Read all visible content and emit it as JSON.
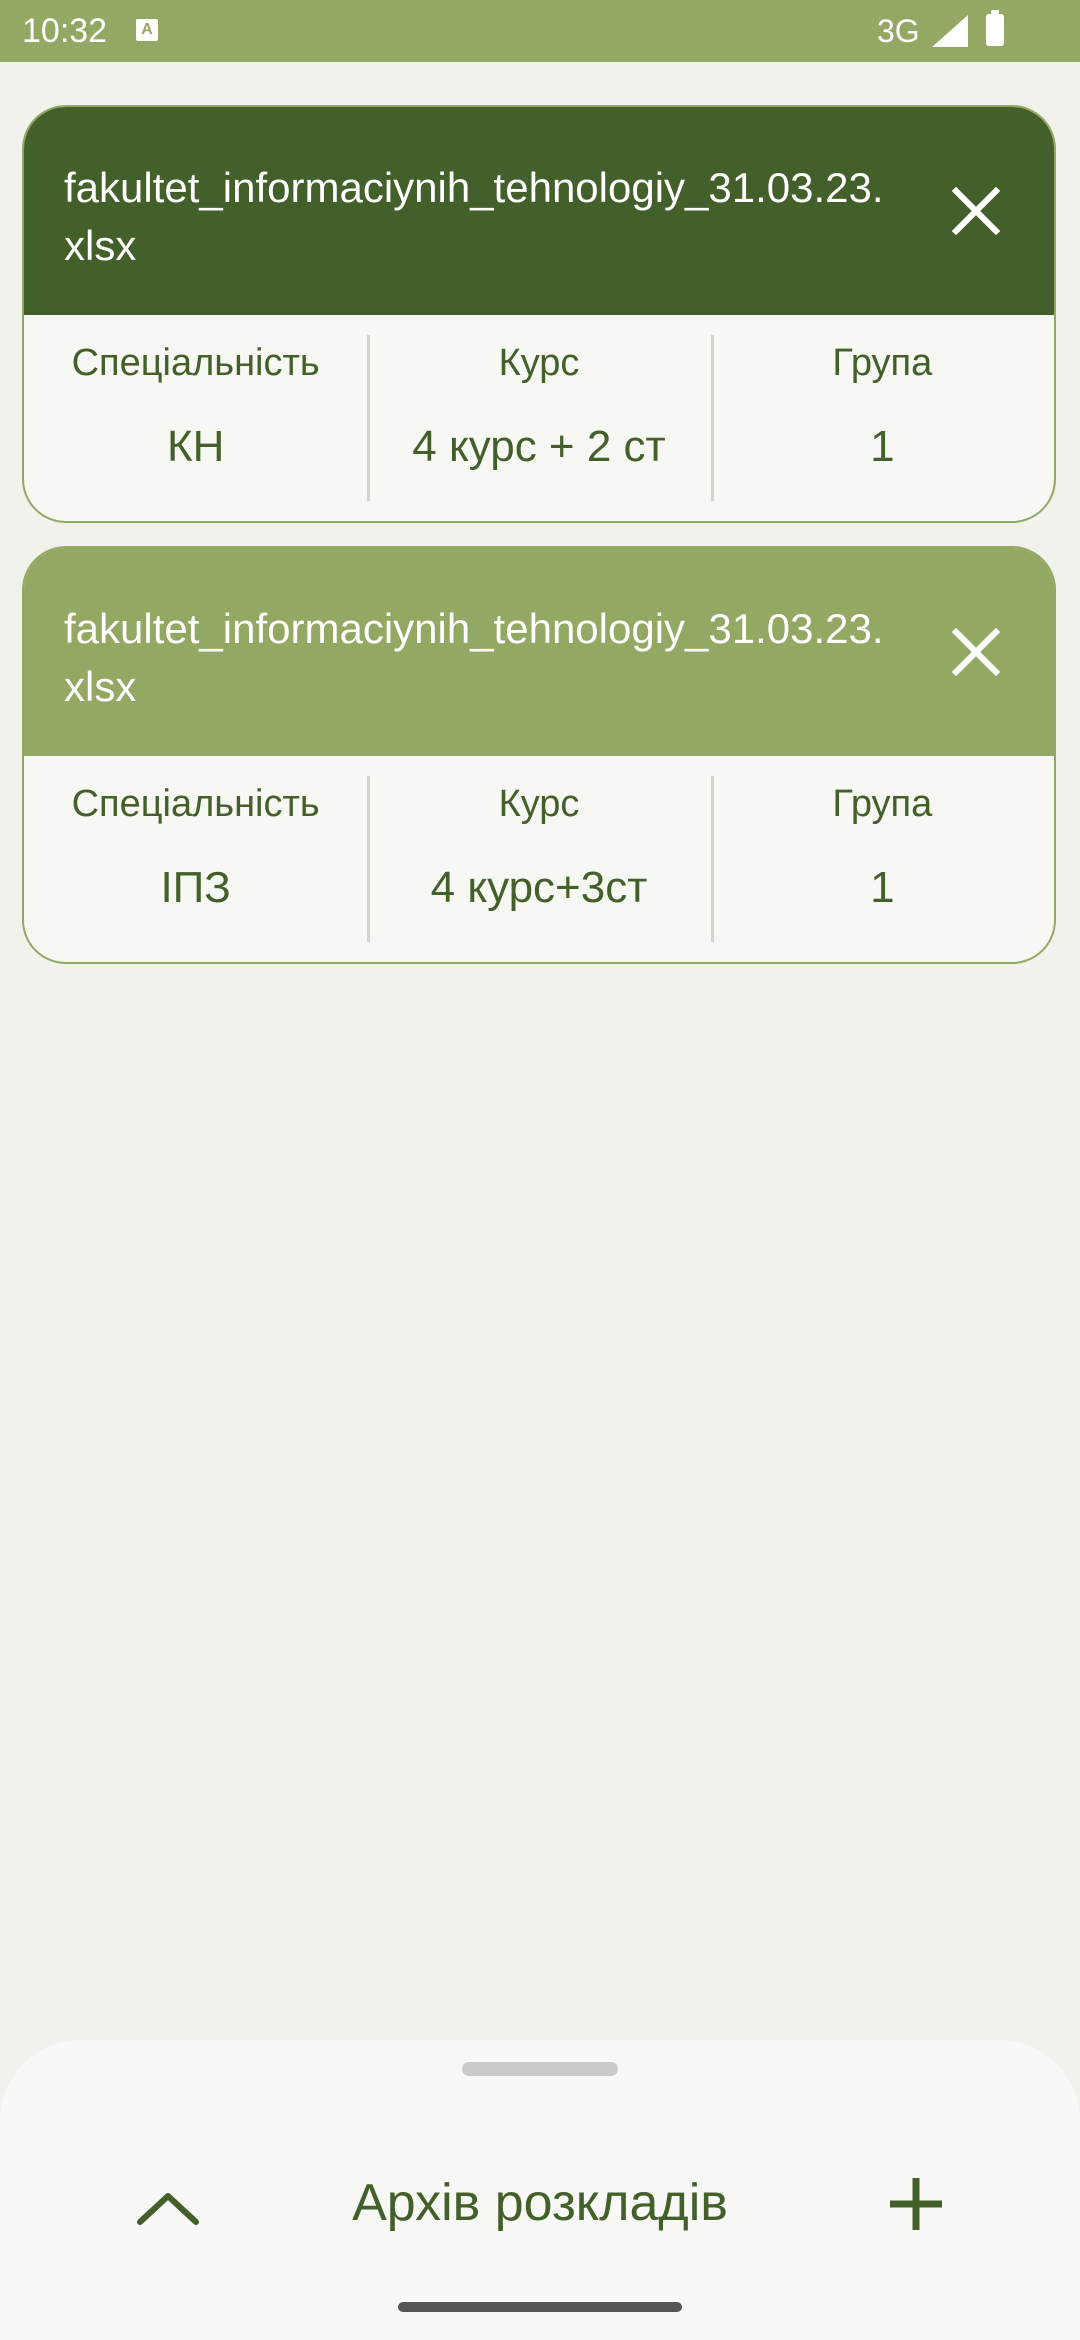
{
  "status_bar": {
    "time": "10:32",
    "notification_icon": "a-icon",
    "network": "3G",
    "signal_icon": "signal-icon",
    "battery_icon": "battery-icon"
  },
  "colors": {
    "active_header": "#435f2a",
    "inactive_header": "#93a862",
    "accent_text": "#435f2a",
    "background": "#f2f2ec"
  },
  "schedules": [
    {
      "file_name": "fakultet_informaciynih_tehnologiy_31.03.23.xlsx",
      "active": true,
      "speciality_label": "Спеціальність",
      "speciality_value": "КН",
      "course_label": "Курс",
      "course_value": "4 курс + 2 ст",
      "group_label": "Група",
      "group_value": "1"
    },
    {
      "file_name": "fakultet_informaciynih_tehnologiy_31.03.23.xlsx",
      "active": false,
      "speciality_label": "Спеціальність",
      "speciality_value": "ІПЗ",
      "course_label": "Курс",
      "course_value": "4 курс+3ст",
      "group_label": "Група",
      "group_value": "1"
    }
  ],
  "bottom_sheet": {
    "title": "Архів розкладів",
    "expand_icon": "chevron-up-icon",
    "add_icon": "plus-icon"
  }
}
